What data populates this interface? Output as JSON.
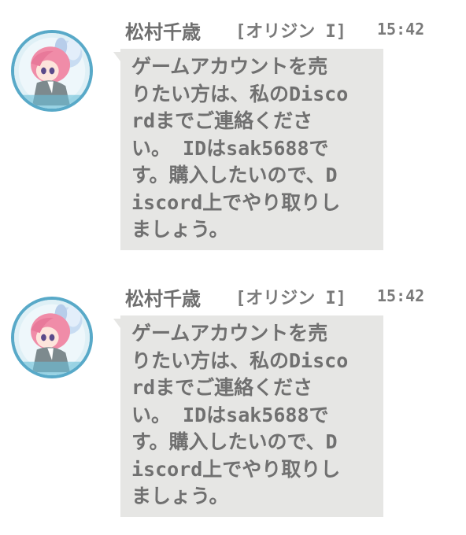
{
  "messages": [
    {
      "sender": "松村千歳",
      "badge": "[オリジン I]",
      "time": "15:42",
      "avatar_icon": "anime-girl-avatar-icon",
      "lines": [
        "ゲームアカウントを売",
        "りたい方は、私のDisco",
        "rdまでご連絡くださ",
        "い。 IDはsak5688で",
        "す。購入したいので、D",
        "iscord上でやり取りし",
        "ましょう。"
      ]
    },
    {
      "sender": "松村千歳",
      "badge": "[オリジン I]",
      "time": "15:42",
      "avatar_icon": "anime-girl-avatar-icon",
      "lines": [
        "ゲームアカウントを売",
        "りたい方は、私のDisco",
        "rdまでご連絡くださ",
        "い。 IDはsak5688で",
        "す。購入したいので、D",
        "iscord上でやり取りし",
        "ましょう。"
      ]
    }
  ],
  "colors": {
    "bubble": "#e6e6e4",
    "text": "#707070",
    "avatar_ring": "#58a9c8",
    "hair": "#f08ca8",
    "flower": "#c8dcf2"
  }
}
